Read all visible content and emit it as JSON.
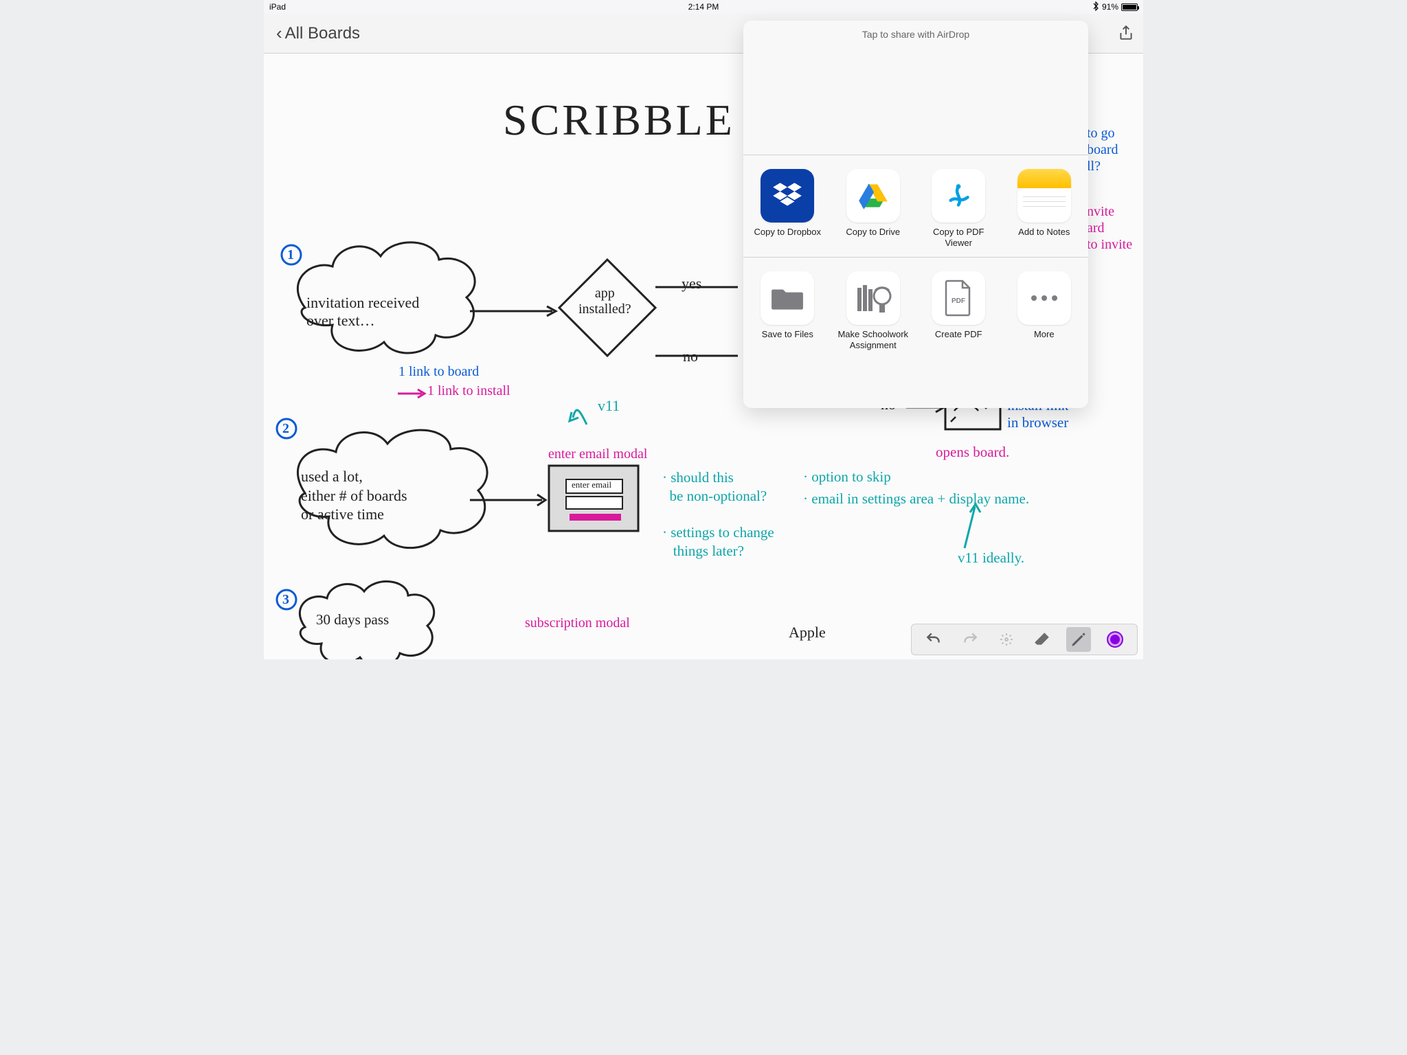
{
  "status_bar": {
    "device": "iPad",
    "time": "2:14 PM",
    "bluetooth": true,
    "battery_percent": "91%"
  },
  "nav": {
    "back_label": "All Boards"
  },
  "share_sheet": {
    "airdrop_hint": "Tap to share with AirDrop",
    "row1": [
      {
        "label": "Copy to Dropbox",
        "icon": "dropbox"
      },
      {
        "label": "Copy to Drive",
        "icon": "gdrive"
      },
      {
        "label": "Copy to PDF Viewer",
        "icon": "pdfviewer"
      },
      {
        "label": "Add to Notes",
        "icon": "notes"
      }
    ],
    "row2": [
      {
        "label": "Save to Files",
        "icon": "files"
      },
      {
        "label": "Make Schoolwork Assignment",
        "icon": "schoolwork"
      },
      {
        "label": "Create PDF",
        "icon": "createpdf"
      },
      {
        "label": "More",
        "icon": "more"
      }
    ]
  },
  "canvas_annotations": {
    "title": "SCRIBBLE",
    "bubble1_num": "1",
    "bubble1_text": "invitation received\nover text…",
    "diamond_text": "app\ninstalled?",
    "diamond_yes": "yes",
    "diamond_no": "no",
    "link_note_l1": "1 link to board",
    "link_note_l2": "1 link to install",
    "bubble2_num": "2",
    "bubble2_text": "used a lot,\neither # of boards\nor active time",
    "enter_email_modal": "enter email modal",
    "v11": "v11",
    "enter_email_label": "enter email",
    "teal_q1": "· should this\n  be non-optional?",
    "teal_q2": "· settings to change\n   things later?",
    "teal_q3": "· option to skip",
    "teal_q4": "· email in settings area + display name.",
    "teal_q5": "v11 ideally.",
    "right_no": "no",
    "install_link": "install link\nin browser",
    "opens_board": "opens board.",
    "bubble3_num": "3",
    "bubble3_text": "30 days pass",
    "subscription_modal": "subscription modal",
    "apple": "Apple",
    "partial_right_text_a": "to go\nboard\nll?",
    "partial_right_text_b": "nvite\nard\nto invite"
  },
  "toolbar": {
    "undo": "undo",
    "redo": "redo",
    "laser": "laser",
    "eraser": "eraser",
    "pen": "pen",
    "color": "color"
  }
}
